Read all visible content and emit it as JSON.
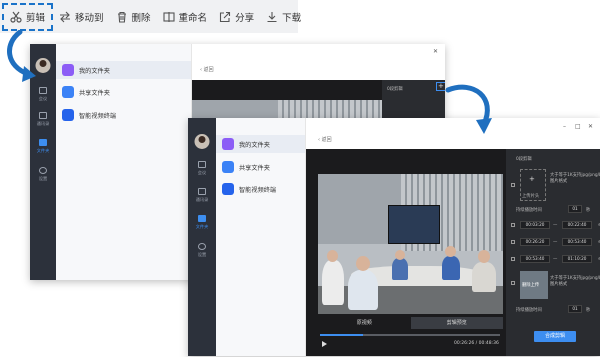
{
  "toolbar": {
    "items": [
      {
        "label": "剪辑",
        "icon": "scissors-icon"
      },
      {
        "label": "移动到",
        "icon": "move-icon"
      },
      {
        "label": "删除",
        "icon": "trash-icon"
      },
      {
        "label": "重命名",
        "icon": "rename-icon"
      },
      {
        "label": "分享",
        "icon": "share-icon"
      },
      {
        "label": "下载",
        "icon": "download-icon"
      }
    ]
  },
  "rail": {
    "items": [
      "会议",
      "通讯录",
      "文件夹",
      "设置"
    ]
  },
  "sidebar": {
    "items": [
      "我的文件夹",
      "共享文件夹",
      "智能视频终端"
    ]
  },
  "header": {
    "back_label": "返回"
  },
  "back_window": {
    "panel_title": "0段剪辑",
    "play_icon": "play-icon"
  },
  "front_window": {
    "panel_title": "0段剪辑",
    "upload_label": "上传片头",
    "upload_hint": "大于等于1K支持jpg/png/bmp图片格式",
    "duration_label": "持续播放时间",
    "duration_value": "01",
    "duration_unit": "秒",
    "clips": [
      {
        "start": "00:03:20",
        "end": "00:22:40"
      },
      {
        "start": "00:26:20",
        "end": "00:53:40"
      },
      {
        "start": "00:53:40",
        "end": "01:10:20"
      }
    ],
    "thumb_label": "删除上传",
    "upload_hint2": "大于等于1K支持jpg/png/bmp图片格式",
    "duration_label2": "持续播放时间",
    "duration_value2": "01",
    "tabs": [
      "原视频",
      "剪辑预览"
    ],
    "current_time": "00:26:26",
    "total_time": "00:48:36",
    "merge_label": "合成剪辑"
  },
  "colors": {
    "accent": "#3d8ef0",
    "dashed_border": "#1a73c9",
    "arrow": "#1f6fbf"
  }
}
